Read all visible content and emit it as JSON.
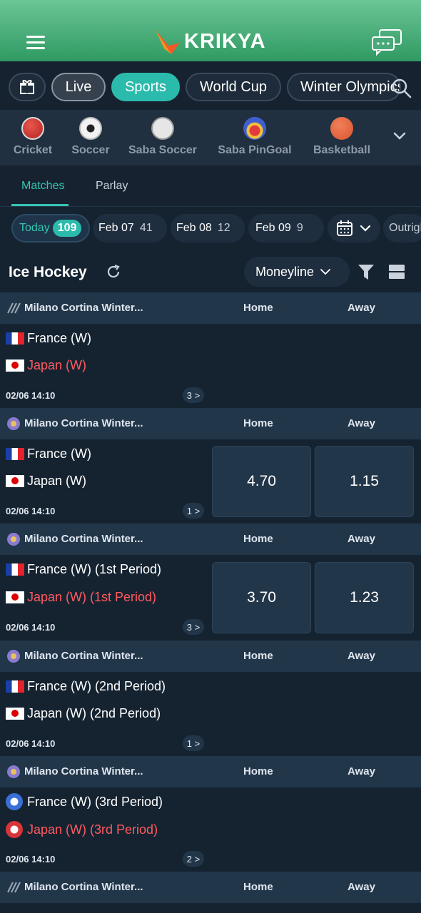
{
  "header": {
    "brand": "KRIKYA"
  },
  "categories": {
    "live": "Live",
    "sports": "Sports",
    "world_cup": "World Cup",
    "winter": "Winter Olympics"
  },
  "sports": [
    {
      "label": "Cricket"
    },
    {
      "label": "Soccer"
    },
    {
      "label": "Saba Soccer"
    },
    {
      "label": "Saba PinGoal"
    },
    {
      "label": "Basketball"
    }
  ],
  "tabs": {
    "matches": "Matches",
    "parlay": "Parlay"
  },
  "dates": {
    "today": {
      "label": "Today",
      "count": "109"
    },
    "feb07": {
      "label": "Feb 07",
      "count": "41"
    },
    "feb08": {
      "label": "Feb 08",
      "count": "12"
    },
    "feb09": {
      "label": "Feb 09",
      "count": "9"
    },
    "outright": "Outright"
  },
  "section": {
    "title": "Ice Hockey",
    "market": "Moneyline"
  },
  "columns": {
    "home": "Home",
    "away": "Away"
  },
  "matches": [
    {
      "league": "Milano Cortina Winter...",
      "team1": "France (W)",
      "team2": "Japan (W)",
      "time": "02/06 14:10",
      "more": "3 >",
      "home_odd": "",
      "away_odd": ""
    },
    {
      "league": "Milano Cortina Winter...",
      "team1": "France (W)",
      "team2": "Japan (W)",
      "time": "02/06 14:10",
      "more": "1 >",
      "home_odd": "4.70",
      "away_odd": "1.15"
    },
    {
      "league": "Milano Cortina Winter...",
      "team1": "France (W) (1st Period)",
      "team2": "Japan (W) (1st Period)",
      "time": "02/06 14:10",
      "more": "3 >",
      "home_odd": "3.70",
      "away_odd": "1.23"
    },
    {
      "league": "Milano Cortina Winter...",
      "team1": "France (W) (2nd Period)",
      "team2": "Japan (W) (2nd Period)",
      "time": "02/06 14:10",
      "more": "1 >",
      "home_odd": "",
      "away_odd": ""
    },
    {
      "league": "Milano Cortina Winter...",
      "team1": "France (W) (3rd Period)",
      "team2": "Japan (W) (3rd Period)",
      "time": "02/06 14:10",
      "more": "2 >",
      "home_odd": "",
      "away_odd": ""
    },
    {
      "league": "Milano Cortina Winter..."
    }
  ]
}
